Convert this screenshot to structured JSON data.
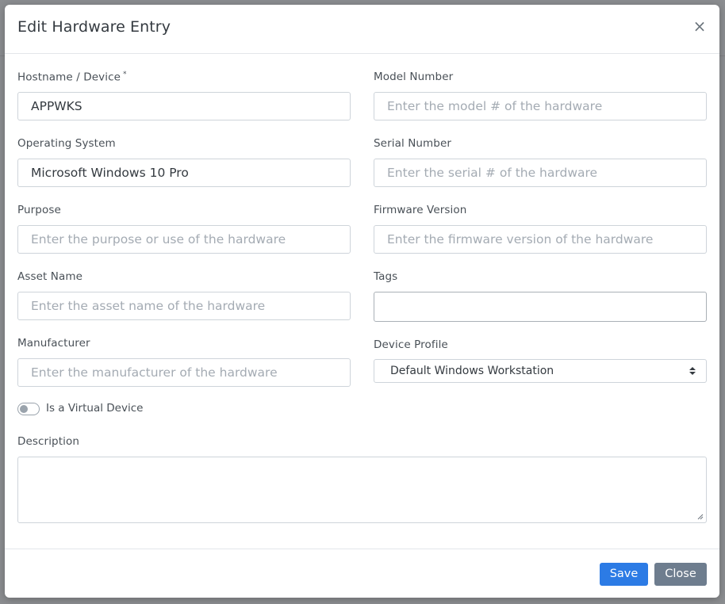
{
  "modal": {
    "title": "Edit Hardware Entry",
    "close_glyph": "×"
  },
  "fields": {
    "hostname": {
      "label": "Hostname / Device",
      "required_mark": "*",
      "value": "APPWKS",
      "placeholder": ""
    },
    "model_number": {
      "label": "Model Number",
      "value": "",
      "placeholder": "Enter the model # of the hardware"
    },
    "operating_system": {
      "label": "Operating System",
      "value": "Microsoft Windows 10 Pro",
      "placeholder": ""
    },
    "serial_number": {
      "label": "Serial Number",
      "value": "",
      "placeholder": "Enter the serial # of the hardware"
    },
    "purpose": {
      "label": "Purpose",
      "value": "",
      "placeholder": "Enter the purpose or use of the hardware"
    },
    "firmware_version": {
      "label": "Firmware Version",
      "value": "",
      "placeholder": "Enter the firmware version of the hardware"
    },
    "asset_name": {
      "label": "Asset Name",
      "value": "",
      "placeholder": "Enter the asset name of the hardware"
    },
    "tags": {
      "label": "Tags"
    },
    "manufacturer": {
      "label": "Manufacturer",
      "value": "",
      "placeholder": "Enter the manufacturer of the hardware"
    },
    "device_profile": {
      "label": "Device Profile",
      "selected": "Default Windows Workstation"
    },
    "virtual_device": {
      "label": "Is a Virtual Device",
      "checked": false
    },
    "description": {
      "label": "Description",
      "value": ""
    }
  },
  "footer": {
    "save_label": "Save",
    "close_label": "Close"
  },
  "colors": {
    "primary": "#2c7be5",
    "secondary": "#6e7d8e",
    "backdrop": "#8b8d90"
  },
  "icons": [
    "close-icon",
    "select-arrows-icon",
    "resize-grip-icon"
  ]
}
